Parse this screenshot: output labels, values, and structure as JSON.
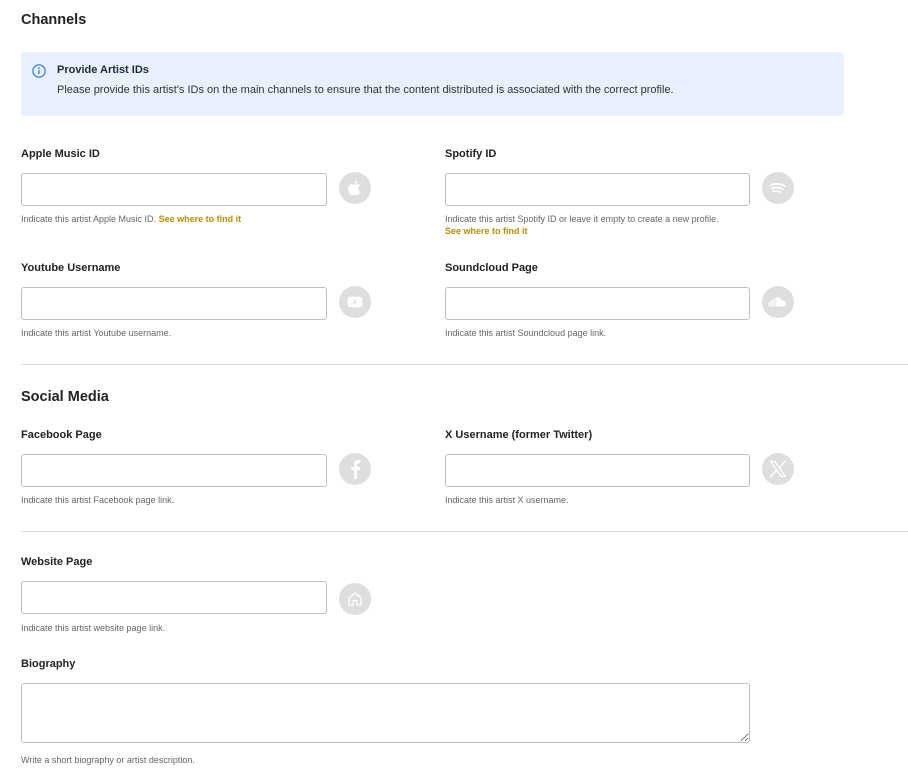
{
  "channels": {
    "title": "Channels",
    "info": {
      "title": "Provide Artist IDs",
      "text": "Please provide this artist's IDs on the main channels to ensure that the content distributed is associated with the correct profile."
    },
    "apple": {
      "label": "Apple Music ID",
      "value": "",
      "placeholder": "",
      "hint": "Indicate this artist Apple Music ID.",
      "link": "See where to find it",
      "icon": "apple-icon"
    },
    "spotify": {
      "label": "Spotify ID",
      "value": "",
      "placeholder": "",
      "hint": "Indicate this artist Spotify ID or leave it empty to create a new profile.",
      "link": "See where to find it",
      "icon": "spotify-icon"
    },
    "youtube": {
      "label": "Youtube Username",
      "value": "",
      "placeholder": "",
      "hint": "Indicate this artist Youtube username.",
      "icon": "youtube-icon"
    },
    "soundcloud": {
      "label": "Soundcloud Page",
      "value": "",
      "placeholder": "",
      "hint": "Indicate this artist Soundcloud page link.",
      "icon": "soundcloud-icon"
    }
  },
  "social": {
    "title": "Social Media",
    "facebook": {
      "label": "Facebook Page",
      "value": "",
      "placeholder": "",
      "hint": "Indicate this artist Facebook page link.",
      "icon": "facebook-icon"
    },
    "x": {
      "label": "X Username (former Twitter)",
      "value": "",
      "placeholder": "",
      "hint": "Indicate this artist X username.",
      "icon": "x-icon"
    }
  },
  "website": {
    "label": "Website Page",
    "value": "",
    "placeholder": "",
    "hint": "Indicate this artist website page link.",
    "icon": "home-icon"
  },
  "biography": {
    "label": "Biography",
    "value": "",
    "placeholder": "",
    "hint": "Write a short biography or artist description."
  },
  "colors": {
    "info_background": "#e8f1fd",
    "info_icon": "#2f7de1",
    "link": "#b98e00",
    "icon_circle": "#dedede",
    "border": "#bfbfbf"
  }
}
